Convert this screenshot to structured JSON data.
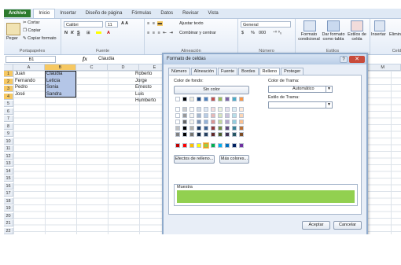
{
  "tabs": [
    "Archivo",
    "Inicio",
    "Insertar",
    "Diseño de página",
    "Fórmulas",
    "Datos",
    "Revisar",
    "Vista"
  ],
  "ribbon": {
    "paste_label": "Pegar",
    "cut_label": "Cortar",
    "copy_label": "Copiar",
    "copy_format_label": "Copiar formato",
    "clipboard_group": "Portapapeles",
    "font_name": "Calibri",
    "font_size": "11",
    "font_group": "Fuente",
    "bold": "N",
    "italic": "K",
    "underline": "S",
    "wrap_text": "Ajustar texto",
    "merge_center": "Combinar y centrar",
    "alignment_group": "Alineación",
    "number_format": "General",
    "currency": "$",
    "percent": "%",
    "thousands": "000",
    "number_group": "Número",
    "cond_format": "Formato condicional",
    "format_table": "Dar formato como tabla",
    "cell_styles": "Estilos de celda",
    "styles_group": "Estilos",
    "insert": "Insertar",
    "delete": "Elimin",
    "cells_group": "Celd"
  },
  "formula_bar": {
    "name_box": "B1",
    "fx": "fx",
    "value": "Claudia"
  },
  "columns": [
    "A",
    "B",
    "C",
    "D",
    "E",
    "M"
  ],
  "rows": [
    "1",
    "2",
    "3",
    "4",
    "5",
    "6",
    "7",
    "8",
    "9",
    "10",
    "11",
    "12",
    "13",
    "14",
    "15",
    "16",
    "17",
    "18",
    "19",
    "20",
    "21",
    "22"
  ],
  "cells": {
    "A": [
      "Juan",
      "Fernando",
      "Pedro",
      "José"
    ],
    "B": [
      "Claudia",
      "Leticia",
      "Sonia",
      "Sandra"
    ],
    "E": [
      "Roberto",
      "Jorge",
      "Ernesto",
      "Luis",
      "Humberto"
    ]
  },
  "dialog": {
    "title": "Formato de celdas",
    "help": "?",
    "close": "✕",
    "tabs": [
      "Número",
      "Alineación",
      "Fuente",
      "Bordes",
      "Relleno",
      "Proteger"
    ],
    "active_tab": "Relleno",
    "bg_color_label": "Color de fondo:",
    "no_color_button": "Sin color",
    "fill_effects_button": "Efectos de relleno...",
    "more_colors_button": "Más colores...",
    "pattern_color_label": "Color de Trama:",
    "pattern_color_value": "Automático",
    "pattern_style_label": "Estilo de Trama:",
    "pattern_style_value": "",
    "sample_label": "Muestra",
    "accept_button": "Aceptar",
    "cancel_button": "Cancelar"
  },
  "colors": {
    "selection_fill": "#b4c6e7",
    "sample_fill": "#92d050",
    "file_tab": "#2d7a2d",
    "close": "#c84b3b",
    "theme_row": [
      "#ffffff",
      "#000000",
      "#eeece1",
      "#1f497d",
      "#4f81bd",
      "#c0504d",
      "#9bbb59",
      "#8064a2",
      "#4bacc6",
      "#f79646"
    ],
    "standard_row": [
      "#c00000",
      "#ff0000",
      "#ffc000",
      "#ffff00",
      "#92d050",
      "#00b050",
      "#00b0f0",
      "#0070c0",
      "#002060",
      "#7030a0"
    ]
  },
  "icons": [
    "cut-icon",
    "copy-icon",
    "format-painter-icon",
    "paste-icon",
    "fx-icon",
    "help-icon",
    "close-icon",
    "dropdown-arrow-icon"
  ]
}
